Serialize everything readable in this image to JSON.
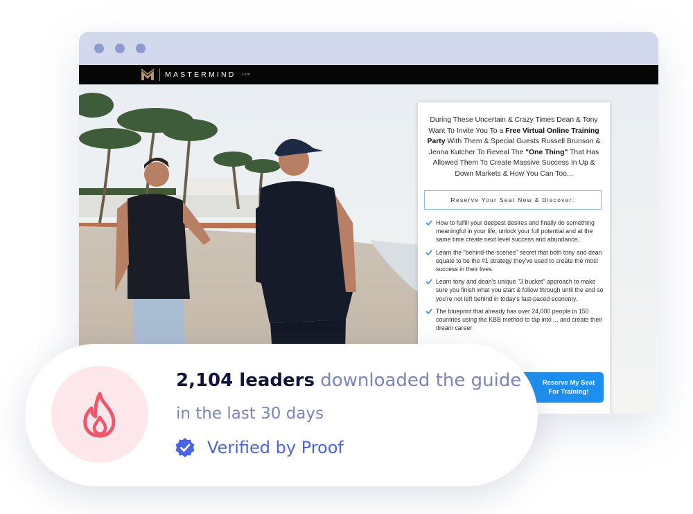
{
  "browser": {
    "site": {
      "logo_text": "MASTERMIND",
      "logo_domain": ".com"
    },
    "panel": {
      "headline": {
        "p1": "During These Uncertain & Crazy Times Dean & Tony Want To Invite You To a ",
        "b1": "Free Virtual Online Training Party",
        "p2": " With Them & Special Guests Russell Brunson & Jenna Kutcher To Reveal The ",
        "b2": "\"One Thing\"",
        "p3": " That Has Allowed Them To Create Massive Success In Up & Down Markets & How You Can Too..."
      },
      "reserve_label": "Reserve Your Seat Now & Discover:",
      "bullets": [
        "How to fulfill your deepest desires and finally do something meaningful in your life, unlock your full potential and at the same time create next level success and abundance.",
        "Learn the \"behind-the-scenes\" secret that both tony and dean equate to be the #1 strategy they've used to create the most success in their lives.",
        "Learn tony and dean's unique \"3 bucket\" approach to make sure you finish what you start & follow through until the end so you're not left behind in today's fast-paced economy.",
        "The blueprint that already has over 24,000 people in 150 countries using the KBB method to tap into ... and create their dream career"
      ],
      "cta_label": "Reserve My Seat For Training!",
      "check_icon": "check-icon"
    }
  },
  "notification": {
    "icon": "flame-icon",
    "count": "2,104 leaders",
    "action": " downloaded the guide",
    "timeframe": "in the last 30 days",
    "verified_label": "Verified by Proof",
    "verified_icon": "verified-badge-icon",
    "colors": {
      "accent": "#4a63e8",
      "flame": "#f0566a",
      "flame_bg": "#fde7ea",
      "muted": "#7b83b8"
    }
  }
}
